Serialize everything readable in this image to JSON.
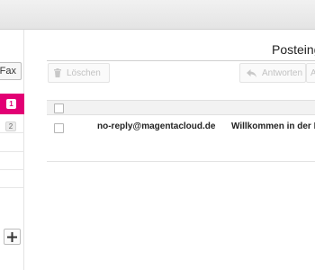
{
  "sidebar": {
    "fax_label": "Fax",
    "active_folder_badge": "1",
    "folder_count_badge": "2"
  },
  "main": {
    "title": "Posteing",
    "toolbar": {
      "delete_label": "Löschen",
      "reply_label": "Antworten",
      "more_label": "A"
    },
    "messages": [
      {
        "sender": "no-reply@magentacloud.de",
        "subject": "Willkommen in der M"
      }
    ]
  },
  "colors": {
    "accent": "#e20074",
    "toolbar_disabled_text": "#c2c2c2"
  }
}
